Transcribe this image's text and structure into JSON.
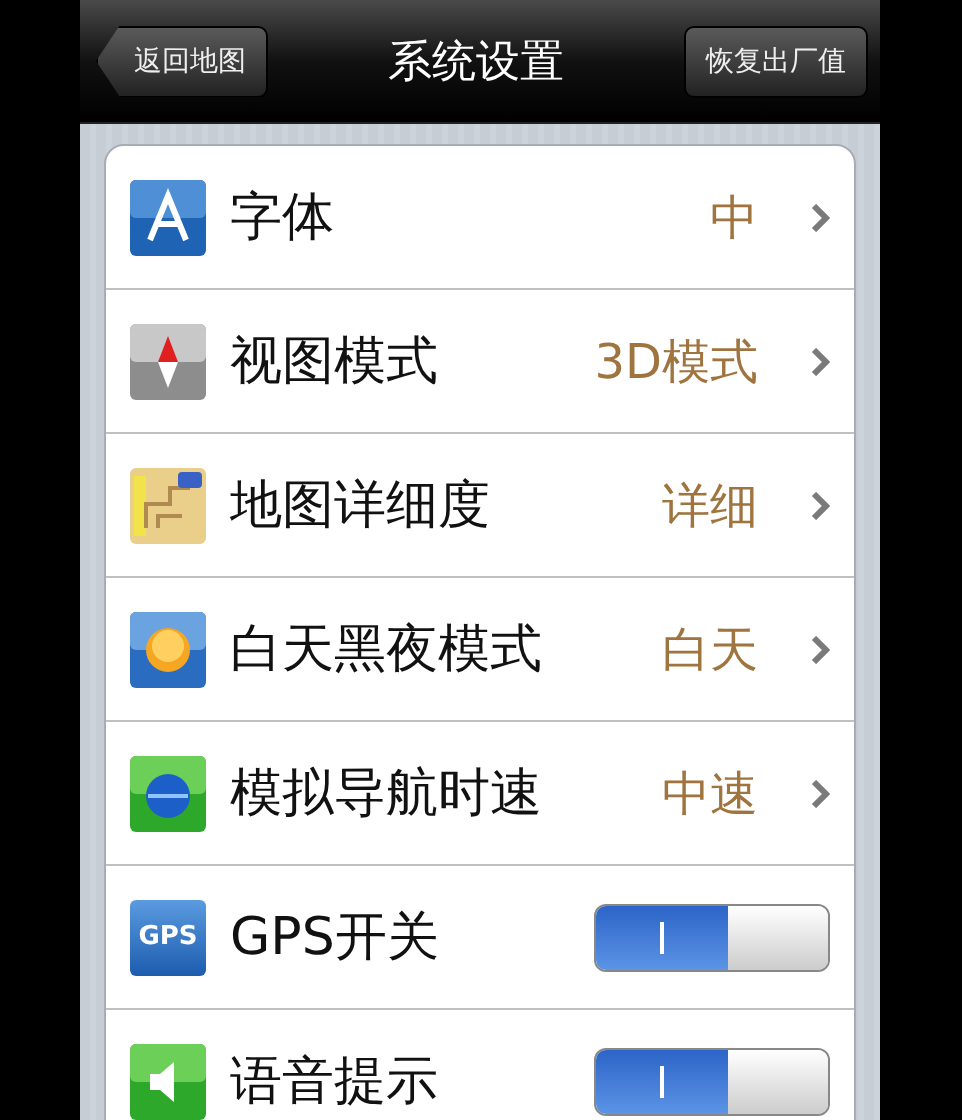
{
  "nav_bar": {
    "back_button": "返回地图",
    "title": "系统设置",
    "right_button": "恢复出厂值"
  },
  "settings": [
    {
      "kind": "disclosure",
      "label": "字体",
      "value": "中"
    },
    {
      "kind": "disclosure",
      "label": "视图模式",
      "value": "3D模式"
    },
    {
      "kind": "disclosure",
      "label": "地图详细度",
      "value": "详细"
    },
    {
      "kind": "disclosure",
      "label": "白天黑夜模式",
      "value": "白天"
    },
    {
      "kind": "disclosure",
      "label": "模拟导航时速",
      "value": "中速"
    },
    {
      "kind": "switch",
      "label": "GPS开关",
      "icon_text": "GPS",
      "on": true
    },
    {
      "kind": "switch",
      "label": "语音提示",
      "on": true
    }
  ]
}
